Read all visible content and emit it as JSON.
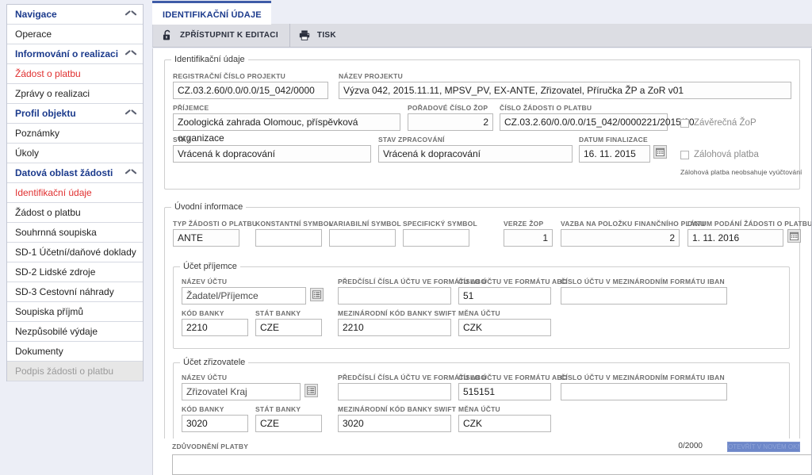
{
  "sidebar": {
    "items": [
      {
        "label": "Navigace",
        "type": "group"
      },
      {
        "label": "Operace",
        "type": "item"
      },
      {
        "label": "Informování o realizaci",
        "type": "group"
      },
      {
        "label": "Žádost o platbu",
        "type": "item-active"
      },
      {
        "label": "Zprávy o realizaci",
        "type": "item"
      },
      {
        "label": "Profil objektu",
        "type": "group"
      },
      {
        "label": "Poznámky",
        "type": "item"
      },
      {
        "label": "Úkoly",
        "type": "item"
      },
      {
        "label": "Datová oblast žádosti",
        "type": "group"
      },
      {
        "label": "Identifikační údaje",
        "type": "item-active"
      },
      {
        "label": "Žádost o platbu",
        "type": "item"
      },
      {
        "label": "Souhrnná soupiska",
        "type": "item"
      },
      {
        "label": "SD-1 Účetní/daňové doklady",
        "type": "item"
      },
      {
        "label": "SD-2 Lidské zdroje",
        "type": "item"
      },
      {
        "label": "SD-3 Cestovní náhrady",
        "type": "item"
      },
      {
        "label": "Soupiska příjmů",
        "type": "item"
      },
      {
        "label": "Nezpůsobilé výdaje",
        "type": "item"
      },
      {
        "label": "Dokumenty",
        "type": "item"
      },
      {
        "label": "Podpis žádosti o platbu",
        "type": "disabled"
      }
    ]
  },
  "tabs": [
    {
      "label": "IDENTIFIKAČNÍ ÚDAJE",
      "active": true
    }
  ],
  "toolbar": {
    "unlock_label": "ZPŘÍSTUPNIT K EDITACI",
    "print_label": "TISK",
    "unlock_icon": "unlock-icon",
    "print_icon": "printer-icon"
  },
  "sections": {
    "identification": {
      "legend": "Identifikační údaje",
      "fields": {
        "registration_number": {
          "label": "REGISTRAČNÍ ČÍSLO PROJEKTU",
          "value": "CZ.03.2.60/0.0/0.0/15_042/0000"
        },
        "project_name": {
          "label": "NÁZEV PROJEKTU",
          "value": "Výzva 042, 2015.11.11, MPSV_PV, EX-ANTE, Zřizovatel, Příručka ŽP a ZoR v01"
        },
        "beneficiary": {
          "label": "PŘÍJEMCE",
          "value": "Zoologická zahrada Olomouc,  příspěvková organizace"
        },
        "zop_order_number": {
          "label": "POŘADOVÉ ČÍSLO ŽOP",
          "value": "2"
        },
        "payment_request_number": {
          "label": "ČÍSLO ŽÁDOSTI O PLATBU",
          "value": "CZ.03.2.60/0.0/0.0/15_042/0000221/2015/00"
        },
        "state": {
          "label": "STAV",
          "value": "Vrácená k dopracování"
        },
        "processing_state": {
          "label": "STAV ZPRACOVÁNÍ",
          "value": "Vrácená k dopracování"
        },
        "finalization_date": {
          "label": "DATUM FINALIZACE",
          "value": "16. 11. 2015"
        }
      },
      "checkboxes": {
        "final_zop": {
          "label": "Závěrečná ŽoP",
          "checked": false
        },
        "advance_payment": {
          "label": "Zálohová platba",
          "checked": false
        }
      },
      "note": "Zálohová platba neobsahuje vyúčtování"
    },
    "intro": {
      "legend": "Úvodní informace",
      "fields": {
        "request_type": {
          "label": "TYP ŽÁDOSTI O PLATBU",
          "value": "ANTE"
        },
        "constant_symbol": {
          "label": "KONSTANTNÍ SYMBOL",
          "value": ""
        },
        "variable_symbol": {
          "label": "VARIABILNÍ SYMBOL",
          "value": ""
        },
        "specific_symbol": {
          "label": "SPECIFICKÝ SYMBOL",
          "value": ""
        },
        "zop_version": {
          "label": "VERZE ŽOP",
          "value": "1"
        },
        "financial_plan_link": {
          "label": "VAZBA NA POLOŽKU FINANČNÍHO PLÁNU",
          "value": "2"
        },
        "submission_date": {
          "label": "DATUM PODÁNÍ ŽÁDOSTI O PLATBU",
          "value": "1. 11. 2016"
        }
      }
    },
    "beneficiary_account": {
      "legend": "Účet příjemce",
      "fields": {
        "account_name": {
          "label": "NÁZEV ÚČTU",
          "value": "Žadatel/Příjemce"
        },
        "abo_prefix": {
          "label": "PŘEDČÍSLÍ ČÍSLA ÚČTU VE FORMÁTU ABO",
          "value": ""
        },
        "abo_number": {
          "label": "ČÍSLO ÚČTU VE FORMÁTU ABO",
          "value": "51"
        },
        "iban": {
          "label": "ČÍSLO ÚČTU V MEZINÁRODNÍM FORMÁTU IBAN",
          "value": ""
        },
        "bank_code": {
          "label": "KÓD BANKY",
          "value": "2210"
        },
        "bank_state": {
          "label": "STÁT BANKY",
          "value": "CZE"
        },
        "swift": {
          "label": "MEZINÁRODNÍ KÓD BANKY SWIFT",
          "value": "2210"
        },
        "currency": {
          "label": "MĚNA ÚČTU",
          "value": "CZK"
        }
      }
    },
    "founder_account": {
      "legend": "Účet zřizovatele",
      "fields": {
        "account_name": {
          "label": "NÁZEV ÚČTU",
          "value": "Zřizovatel Kraj"
        },
        "abo_prefix": {
          "label": "PŘEDČÍSLÍ ČÍSLA ÚČTU VE FORMÁTU ABO",
          "value": ""
        },
        "abo_number": {
          "label": "ČÍSLO ÚČTU VE FORMÁTU ABO",
          "value": "515151"
        },
        "iban": {
          "label": "ČÍSLO ÚČTU V MEZINÁRODNÍM FORMÁTU IBAN",
          "value": ""
        },
        "bank_code": {
          "label": "KÓD BANKY",
          "value": "3020"
        },
        "bank_state": {
          "label": "STÁT BANKY",
          "value": "CZE"
        },
        "swift": {
          "label": "MEZINÁRODNÍ KÓD BANKY SWIFT",
          "value": "3020"
        },
        "currency": {
          "label": "MĚNA ÚČTU",
          "value": "CZK"
        }
      }
    },
    "payment_reason": {
      "label": "ZDŮVODNĚNÍ PLATBY",
      "counter": "0/2000",
      "value": "",
      "action_button": "OTEVŘÍT V NOVÉM OKNĚ"
    }
  },
  "colors": {
    "accent": "#1b3a8c",
    "active_red": "#e03030",
    "page_bg": "#eceef6",
    "toolbar_bg": "#dcdde3",
    "button_blue": "#6d87c9"
  }
}
